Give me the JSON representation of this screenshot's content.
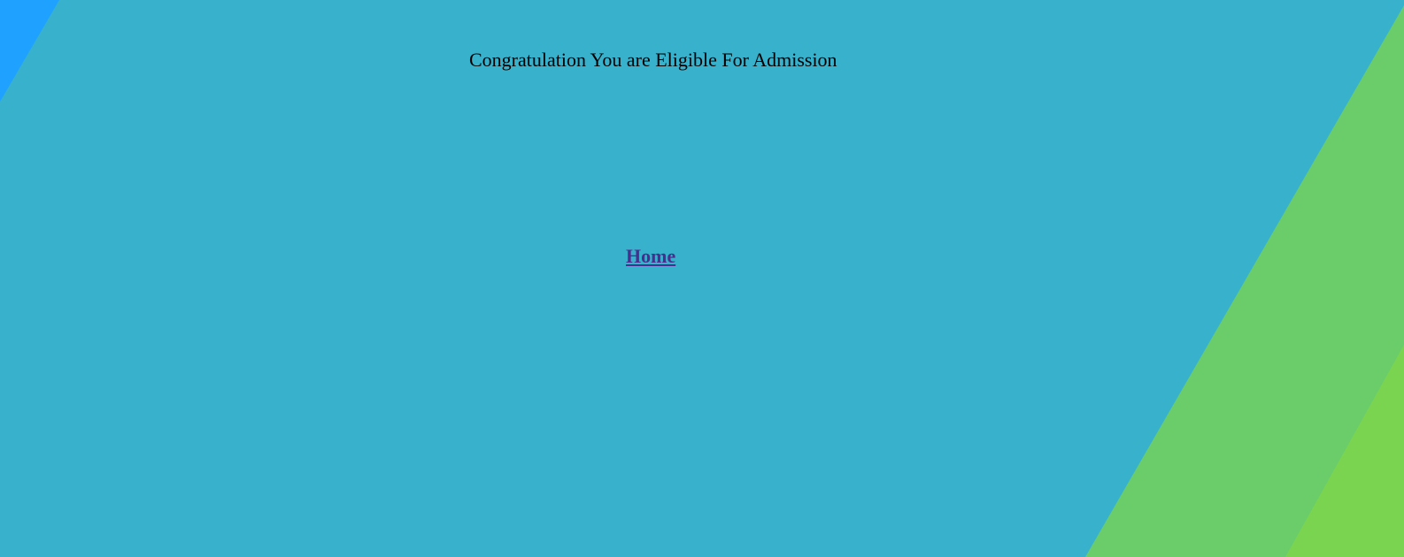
{
  "page": {
    "message": "Congratulation You are Eligible For Admission",
    "home_link_label": "Home"
  },
  "theme": {
    "background_main": "#38b2cc",
    "background_top_left": "#1fa2ff",
    "background_right_band": "#6bcd6a",
    "background_right_corner": "#7bd44f",
    "link_color": "#4f2a8f",
    "text_color": "#000000"
  }
}
